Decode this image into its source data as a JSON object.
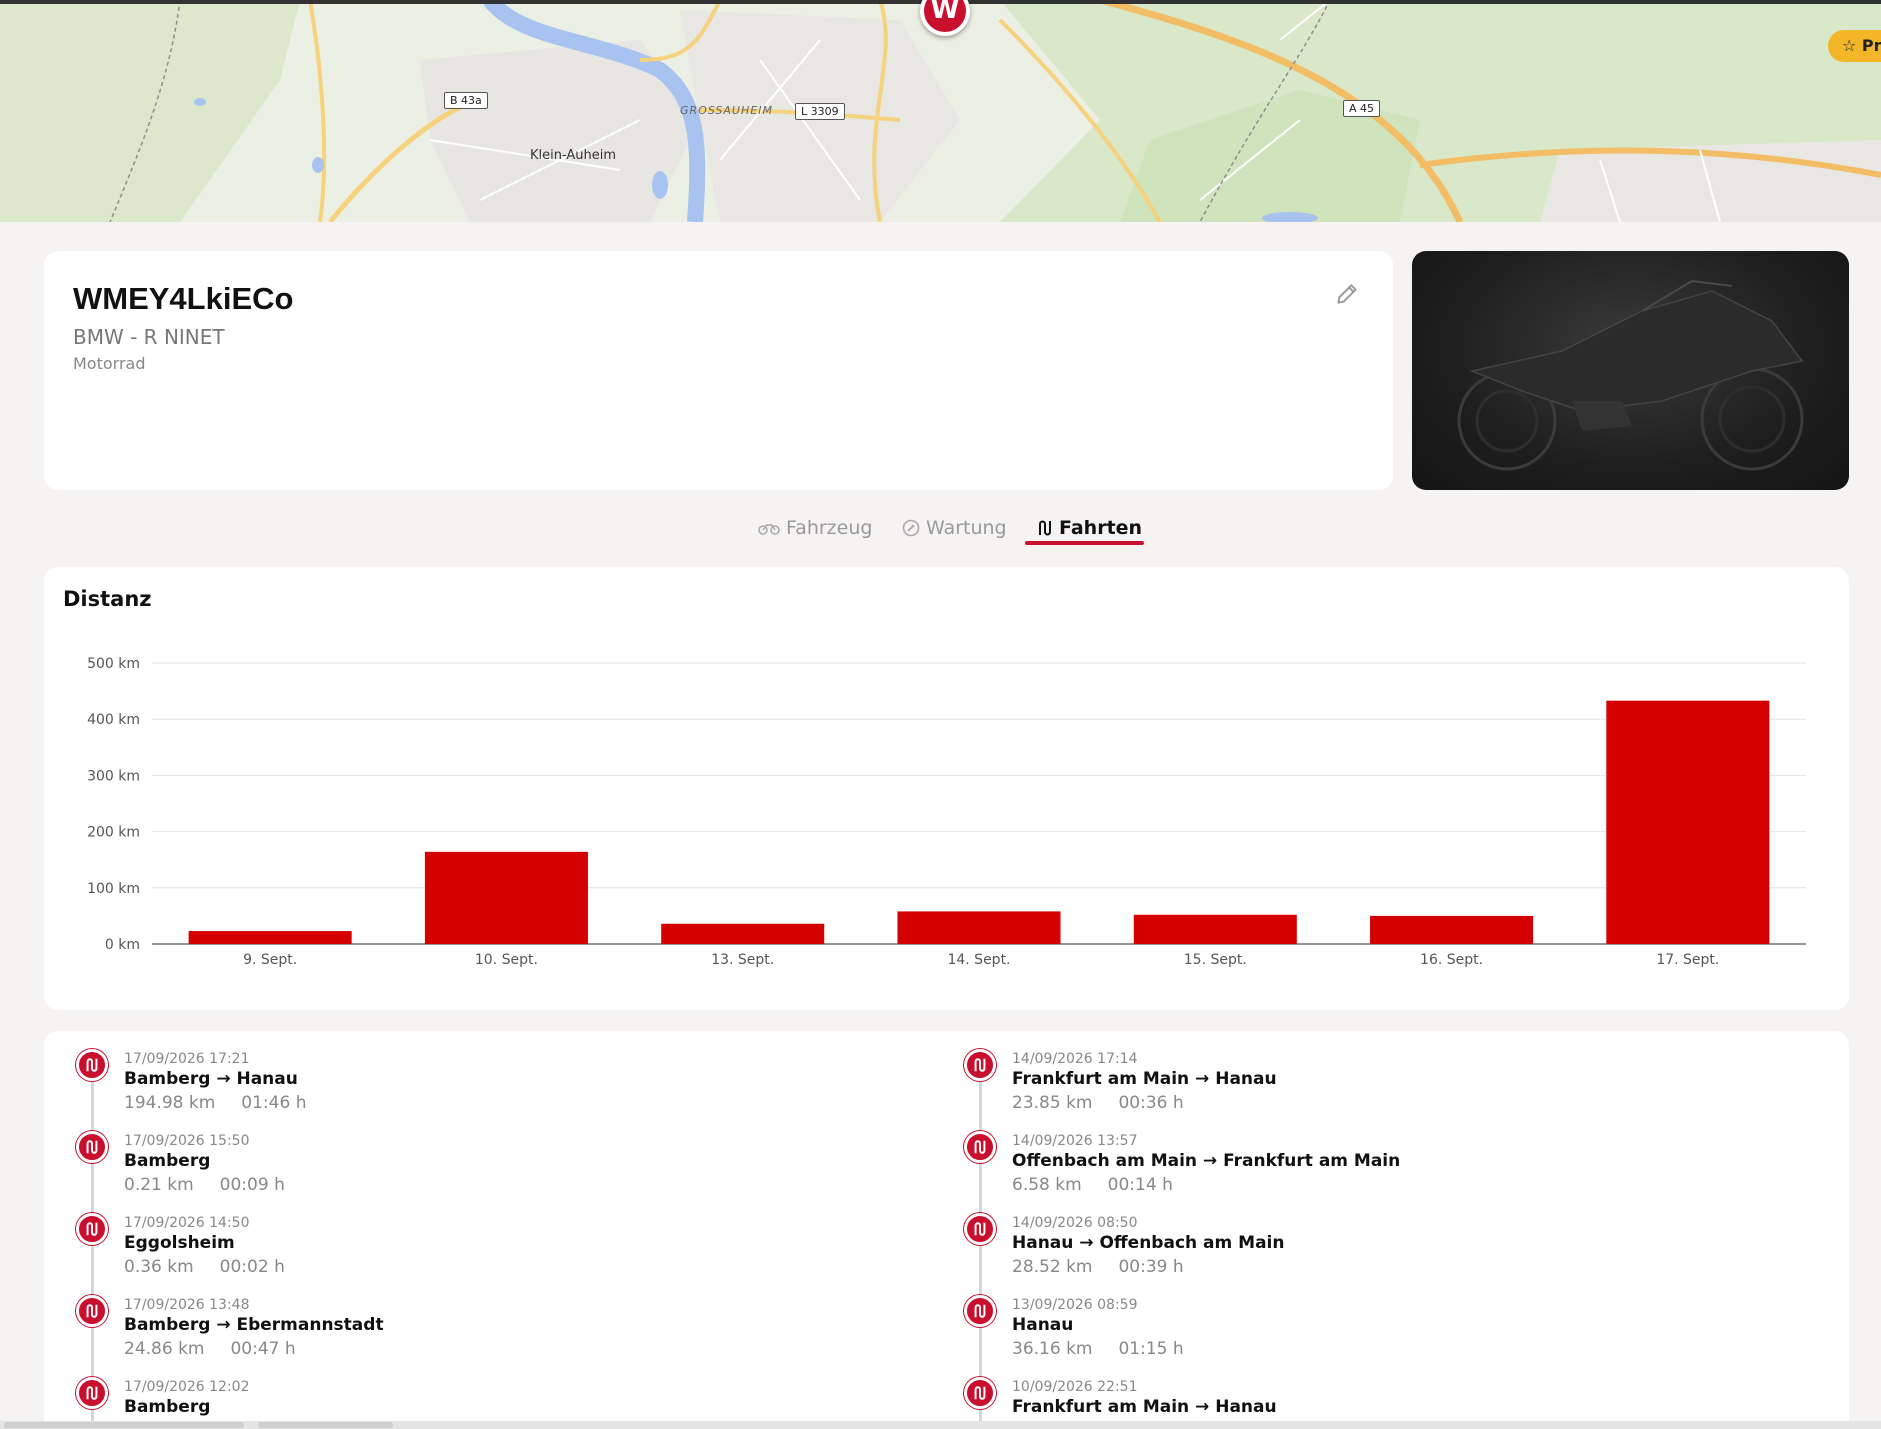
{
  "map": {
    "labels": {
      "town": "Klein-Auheim",
      "district": "GROSSAUHEIM",
      "road_b43a": "B 43a",
      "road_l3309": "L 3309",
      "road_a45": "A 45"
    },
    "pin_letter": "W",
    "premium_badge": "☆ Pr"
  },
  "vehicle": {
    "id": "WMEY4LkiECo",
    "model": "BMW - R NINET",
    "type": "Motorrad",
    "edit_icon": "pencil-icon"
  },
  "tabs": [
    {
      "label": "Fahrzeug",
      "icon": "bike-icon",
      "active": false
    },
    {
      "label": "Wartung",
      "icon": "wrench-icon",
      "active": false
    },
    {
      "label": "Fahrten",
      "icon": "route-icon",
      "active": true
    }
  ],
  "chart": {
    "title": "Distanz"
  },
  "chart_data": {
    "type": "bar",
    "title": "Distanz",
    "categories": [
      "9. Sept.",
      "10. Sept.",
      "13. Sept.",
      "14. Sept.",
      "15. Sept.",
      "16. Sept.",
      "17. Sept."
    ],
    "values": [
      23,
      164,
      36,
      58,
      52,
      50,
      433
    ],
    "yticks": [
      "0 km",
      "100 km",
      "200 km",
      "300 km",
      "400 km",
      "500 km"
    ],
    "ylim": [
      0,
      500
    ],
    "grid": true,
    "color": "#d50000"
  },
  "trips": {
    "left": [
      {
        "date": "17/09/2026 17:21",
        "route": "Bamberg → Hanau",
        "distance": "194.98 km",
        "duration": "01:46 h"
      },
      {
        "date": "17/09/2026 15:50",
        "route": "Bamberg",
        "distance": "0.21 km",
        "duration": "00:09 h"
      },
      {
        "date": "17/09/2026 14:50",
        "route": "Eggolsheim",
        "distance": "0.36 km",
        "duration": "00:02 h"
      },
      {
        "date": "17/09/2026 13:48",
        "route": "Bamberg → Ebermannstadt",
        "distance": "24.86 km",
        "duration": "00:47 h"
      },
      {
        "date": "17/09/2026 12:02",
        "route": "Bamberg",
        "distance": "",
        "duration": ""
      }
    ],
    "right": [
      {
        "date": "14/09/2026 17:14",
        "route": "Frankfurt am Main → Hanau",
        "distance": "23.85 km",
        "duration": "00:36 h"
      },
      {
        "date": "14/09/2026 13:57",
        "route": "Offenbach am Main → Frankfurt am Main",
        "distance": "6.58 km",
        "duration": "00:14 h"
      },
      {
        "date": "14/09/2026 08:50",
        "route": "Hanau → Offenbach am Main",
        "distance": "28.52 km",
        "duration": "00:39 h"
      },
      {
        "date": "13/09/2026 08:59",
        "route": "Hanau",
        "distance": "36.16 km",
        "duration": "01:15 h"
      },
      {
        "date": "10/09/2026 22:51",
        "route": "Frankfurt am Main → Hanau",
        "distance": "",
        "duration": ""
      }
    ]
  }
}
